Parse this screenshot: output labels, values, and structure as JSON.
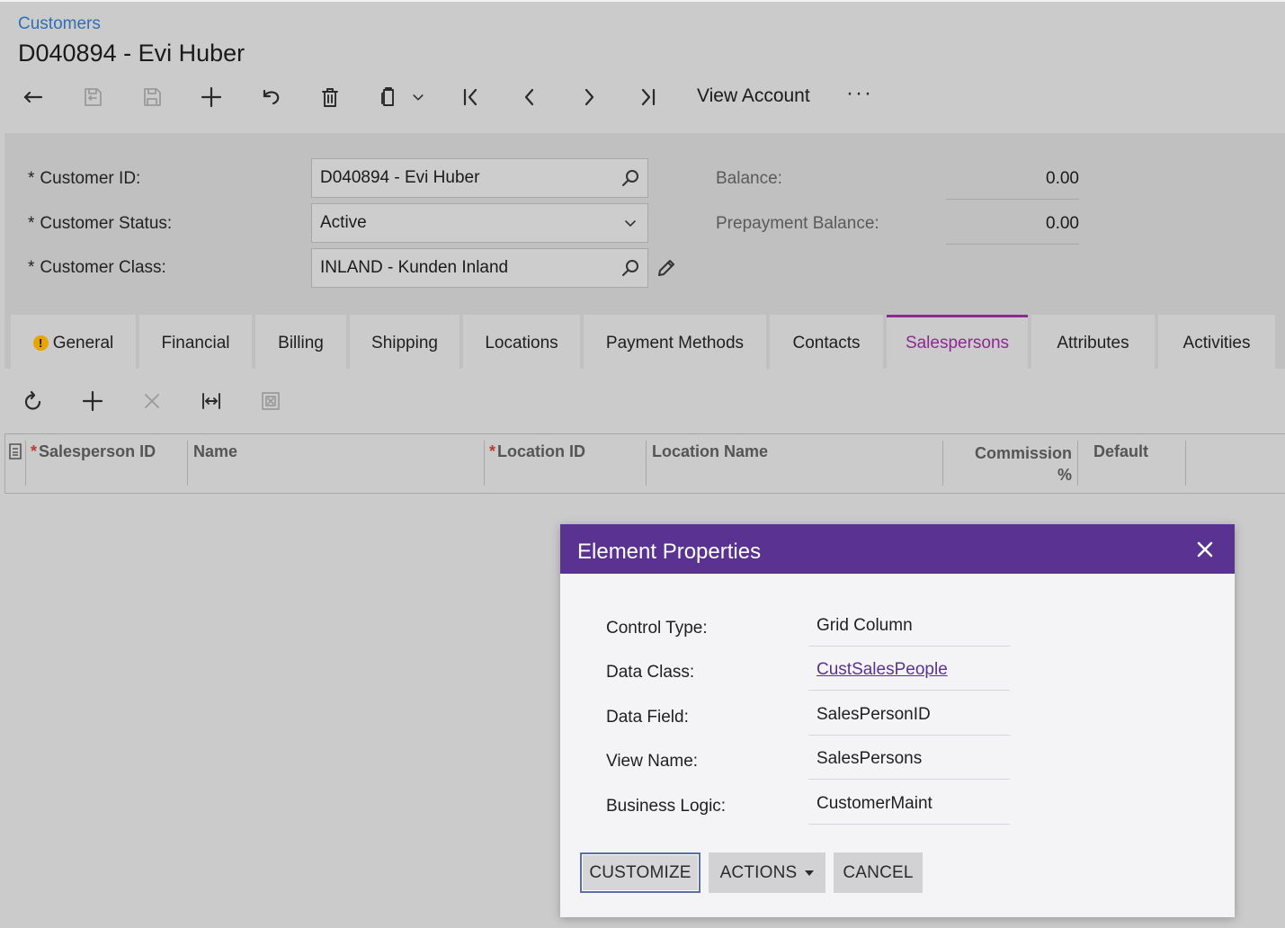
{
  "breadcrumb": "Customers",
  "title": "D040894 - Evi Huber",
  "toolbar": {
    "view_account": "View Account",
    "more": "···"
  },
  "form": {
    "customer_id": {
      "label": "Customer ID:",
      "value": "D040894 - Evi Huber"
    },
    "customer_status": {
      "label": "Customer Status:",
      "value": "Active"
    },
    "customer_class": {
      "label": "Customer Class:",
      "value": "INLAND - Kunden Inland"
    },
    "required_mark": "*",
    "balance": {
      "label": "Balance:",
      "value": "0.00"
    },
    "prepayment_balance": {
      "label": "Prepayment Balance:",
      "value": "0.00"
    }
  },
  "tabs": [
    {
      "label": "General",
      "warning": "!"
    },
    {
      "label": "Financial"
    },
    {
      "label": "Billing"
    },
    {
      "label": "Shipping"
    },
    {
      "label": "Locations"
    },
    {
      "label": "Payment Methods"
    },
    {
      "label": "Contacts"
    },
    {
      "label": "Salespersons",
      "active": true
    },
    {
      "label": "Attributes"
    },
    {
      "label": "Activities"
    }
  ],
  "grid": {
    "columns": [
      {
        "label": "Salesperson ID",
        "required": true
      },
      {
        "label": "Name"
      },
      {
        "label": "Location ID",
        "required": true
      },
      {
        "label": "Location Name"
      },
      {
        "label": "Commission %"
      },
      {
        "label": "Default"
      }
    ],
    "required_mark": "*"
  },
  "dialog": {
    "title": "Element Properties",
    "rows": [
      {
        "label": "Control Type:",
        "value": "Grid Column"
      },
      {
        "label": "Data Class:",
        "value": "CustSalesPeople"
      },
      {
        "label": "Data Field:",
        "value": "SalesPersonID"
      },
      {
        "label": "View Name:",
        "value": "SalesPersons"
      },
      {
        "label": "Business Logic:",
        "value": "CustomerMaint"
      }
    ],
    "buttons": {
      "customize": "CUSTOMIZE",
      "actions": "ACTIONS",
      "cancel": "CANCEL"
    }
  },
  "colors": {
    "accent_tab": "#8a2b8f",
    "dialog_header": "#5a3292",
    "breadcrumb": "#2f6fb5",
    "required": "#c0392b"
  },
  "icons": [
    "back-icon",
    "save-close-icon",
    "save-icon",
    "add-icon",
    "undo-icon",
    "delete-icon",
    "clipboard-icon",
    "chevron-down-icon",
    "first-icon",
    "prev-icon",
    "next-icon",
    "last-icon",
    "search-icon",
    "pencil-icon",
    "refresh-icon",
    "close-icon",
    "fit-columns-icon",
    "excel-export-icon",
    "row-selector-icon"
  ]
}
